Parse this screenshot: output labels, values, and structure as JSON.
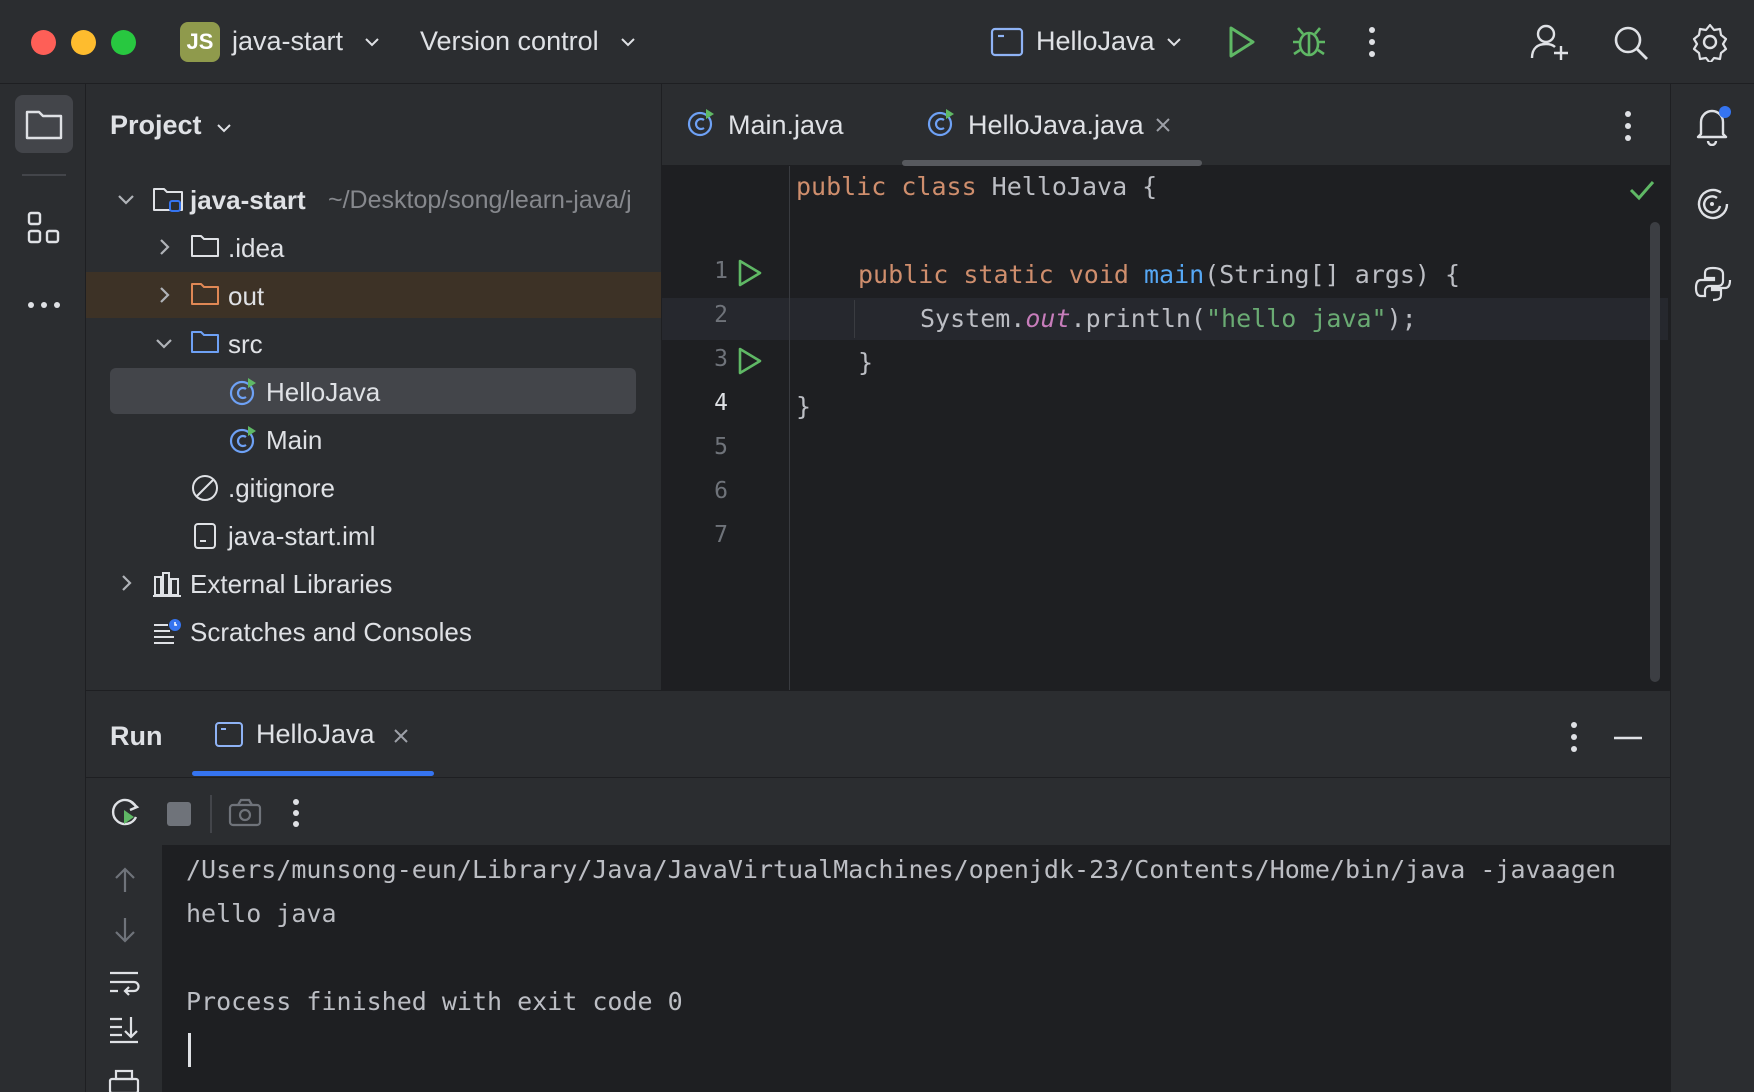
{
  "titlebar": {
    "project_initials": "JS",
    "project_name": "java-start",
    "vcs_label": "Version control",
    "run_config": "HelloJava"
  },
  "project_panel": {
    "title": "Project",
    "tree": {
      "root_name": "java-start",
      "root_path": "~/Desktop/song/learn-java/j",
      "idea": ".idea",
      "out": "out",
      "src": "src",
      "hellojava": "HelloJava",
      "main": "Main",
      "gitignore": ".gitignore",
      "iml": "java-start.iml",
      "external_libraries": "External Libraries",
      "scratches": "Scratches and Consoles"
    }
  },
  "editor": {
    "tabs": [
      {
        "label": "Main.java"
      },
      {
        "label": "HelloJava.java"
      }
    ],
    "line_numbers": [
      "1",
      "2",
      "3",
      "4",
      "5",
      "6",
      "7"
    ],
    "code": {
      "l1_kw": "public class ",
      "l1_rest": "HelloJava {",
      "l3_kw": "public static void ",
      "l3_fn": "main",
      "l3_rest": "(String[] args) {",
      "l4_a": "System.",
      "l4_out": "out",
      "l4_b": ".println(",
      "l4_str": "\"hello java\"",
      "l4_c": ");",
      "l5": "}",
      "l6": "}"
    }
  },
  "run_panel": {
    "title": "Run",
    "tab_label": "HelloJava",
    "console": [
      "/Users/munsong-eun/Library/Java/JavaVirtualMachines/openjdk-23/Contents/Home/bin/java -javaagen",
      "hello java",
      "",
      "Process finished with exit code 0"
    ]
  },
  "colors": {
    "accent": "#3574f0",
    "run_green": "#5fb865",
    "folder_excluded": "#e08855",
    "traffic_red": "#fe5f57",
    "traffic_yellow": "#febc2e",
    "traffic_green": "#28c840"
  }
}
